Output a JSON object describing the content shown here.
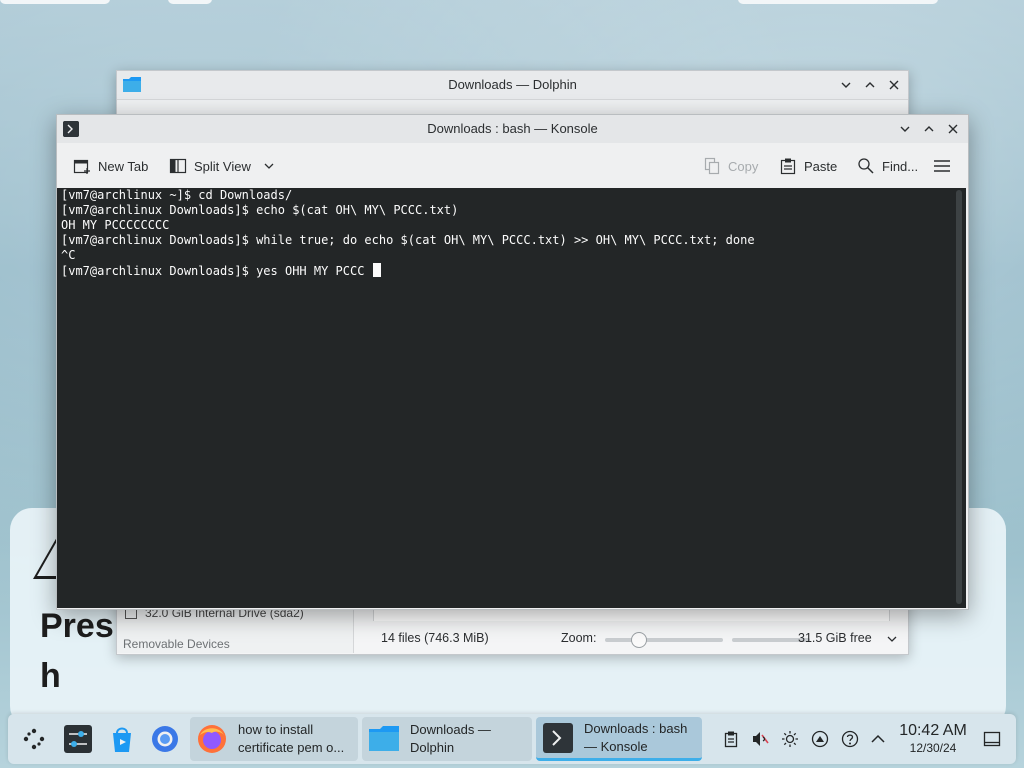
{
  "background": {
    "lines": [
      "Pres",
      "h"
    ]
  },
  "dolphin": {
    "title": "Downloads — Dolphin",
    "sidebar": {
      "drive_label": "32.0 GiB Internal Drive (sda2)",
      "section_label": "Removable Devices"
    },
    "status": {
      "file_count": "14 files (746.3 MiB)",
      "zoom_label": "Zoom:",
      "zoom_level": 0.25,
      "free_space": "31.5 GiB free",
      "used_space_fraction": 0.15
    }
  },
  "konsole": {
    "title": "Downloads : bash — Konsole",
    "toolbar": {
      "new_tab": "New Tab",
      "split_view": "Split View",
      "copy": "Copy",
      "paste": "Paste",
      "find": "Find..."
    },
    "terminal_lines": [
      "[vm7@archlinux ~]$ cd Downloads/",
      "[vm7@archlinux Downloads]$ echo $(cat OH\\ MY\\ PCCC.txt)",
      "OH MY PCCCCCCCC",
      "[vm7@archlinux Downloads]$ while true; do echo $(cat OH\\ MY\\ PCCC.txt) >> OH\\ MY\\ PCCC.txt; done",
      "^C",
      "[vm7@archlinux Downloads]$ yes OHH MY PCCC "
    ]
  },
  "taskbar": {
    "tasks": [
      {
        "line1": "how to install",
        "line2": "certificate pem o..."
      },
      {
        "line1": "Downloads —",
        "line2": "Dolphin"
      },
      {
        "line1": "Downloads : bash",
        "line2": "— Konsole"
      }
    ],
    "clock": {
      "time": "10:42 AM",
      "date": "12/30/24"
    }
  },
  "colors": {
    "accent": "#3daee9",
    "terminal_bg": "#232627",
    "terminal_fg": "#fcfcfc"
  }
}
